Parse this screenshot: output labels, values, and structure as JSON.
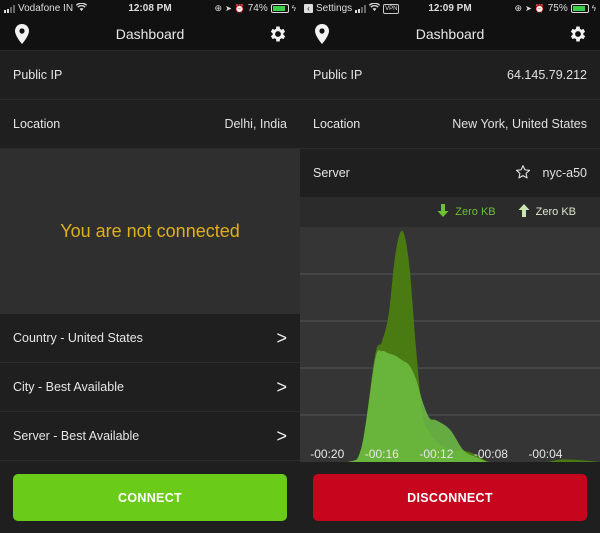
{
  "left": {
    "status_bar": {
      "carrier": "Vodafone IN",
      "time": "12:08 PM",
      "battery": "74%",
      "battery_level": 0.74
    },
    "nav": {
      "title": "Dashboard",
      "left_icon": "location-pin-icon",
      "right_icon": "gear-icon"
    },
    "info_rows": [
      {
        "label": "Public IP",
        "value": ""
      },
      {
        "label": "Location",
        "value": "Delhi, India"
      }
    ],
    "status_message": "You are not connected",
    "selectors": [
      {
        "label": "Country - United States",
        "chevron": ">"
      },
      {
        "label": "City - Best Available",
        "chevron": ">"
      },
      {
        "label": "Server - Best Available",
        "chevron": ">"
      }
    ],
    "button": {
      "label": "CONNECT",
      "color": "#6acb19"
    }
  },
  "right": {
    "status_bar": {
      "back_app": "Settings",
      "vpn_badge": "VPN",
      "time": "12:09 PM",
      "battery": "75%",
      "battery_level": 0.75
    },
    "nav": {
      "title": "Dashboard",
      "left_icon": "location-pin-icon",
      "right_icon": "gear-icon"
    },
    "info_rows": [
      {
        "label": "Public IP",
        "value": "64.145.79.212"
      },
      {
        "label": "Location",
        "value": "New York, United States"
      },
      {
        "label": "Server",
        "value": "nyc-a50",
        "icon": "star-outline-icon"
      }
    ],
    "traffic_legend": {
      "download": {
        "label": "Zero KB",
        "icon": "arrow-down-icon",
        "color": "#6fbf2e"
      },
      "upload": {
        "label": "Zero KB",
        "icon": "arrow-up-icon",
        "color": "#c8e6b0"
      }
    },
    "button": {
      "label": "DISCONNECT",
      "color": "#c5061c"
    }
  },
  "chart_data": {
    "type": "area",
    "title": "",
    "xlabel": "",
    "ylabel": "",
    "x_ticks": [
      "-00:20",
      "-00:16",
      "-00:12",
      "-00:08",
      "-00:04"
    ],
    "xlim": [
      -22,
      0
    ],
    "ylim": [
      0,
      5
    ],
    "grid": true,
    "gridlines": 4,
    "x": [
      -22,
      -18.5,
      -17.5,
      -16.5,
      -16,
      -15.5,
      -15,
      -14.5,
      -14,
      -13.5,
      -13,
      -12.5,
      -12,
      -11,
      -10,
      -9,
      -8.5,
      -8,
      -6,
      -4,
      -3,
      -2,
      -1,
      0
    ],
    "series": [
      {
        "name": "download",
        "color": "#4a7a12",
        "values": [
          0,
          0,
          0.3,
          2.3,
          2.6,
          3.2,
          4.5,
          5.0,
          4.3,
          2.5,
          1.0,
          0.65,
          0.45,
          0.25,
          0.25,
          0.15,
          0.05,
          0,
          0,
          0,
          0.05,
          0.05,
          0.03,
          0
        ]
      },
      {
        "name": "upload",
        "color": "#6fbf44",
        "values": [
          0,
          0,
          0.3,
          2.2,
          2.4,
          2.35,
          2.3,
          2.2,
          2.1,
          1.8,
          1.3,
          0.95,
          0.9,
          0.7,
          0.25,
          0.1,
          0.03,
          0,
          0,
          0,
          0,
          0,
          0,
          0
        ]
      }
    ]
  }
}
